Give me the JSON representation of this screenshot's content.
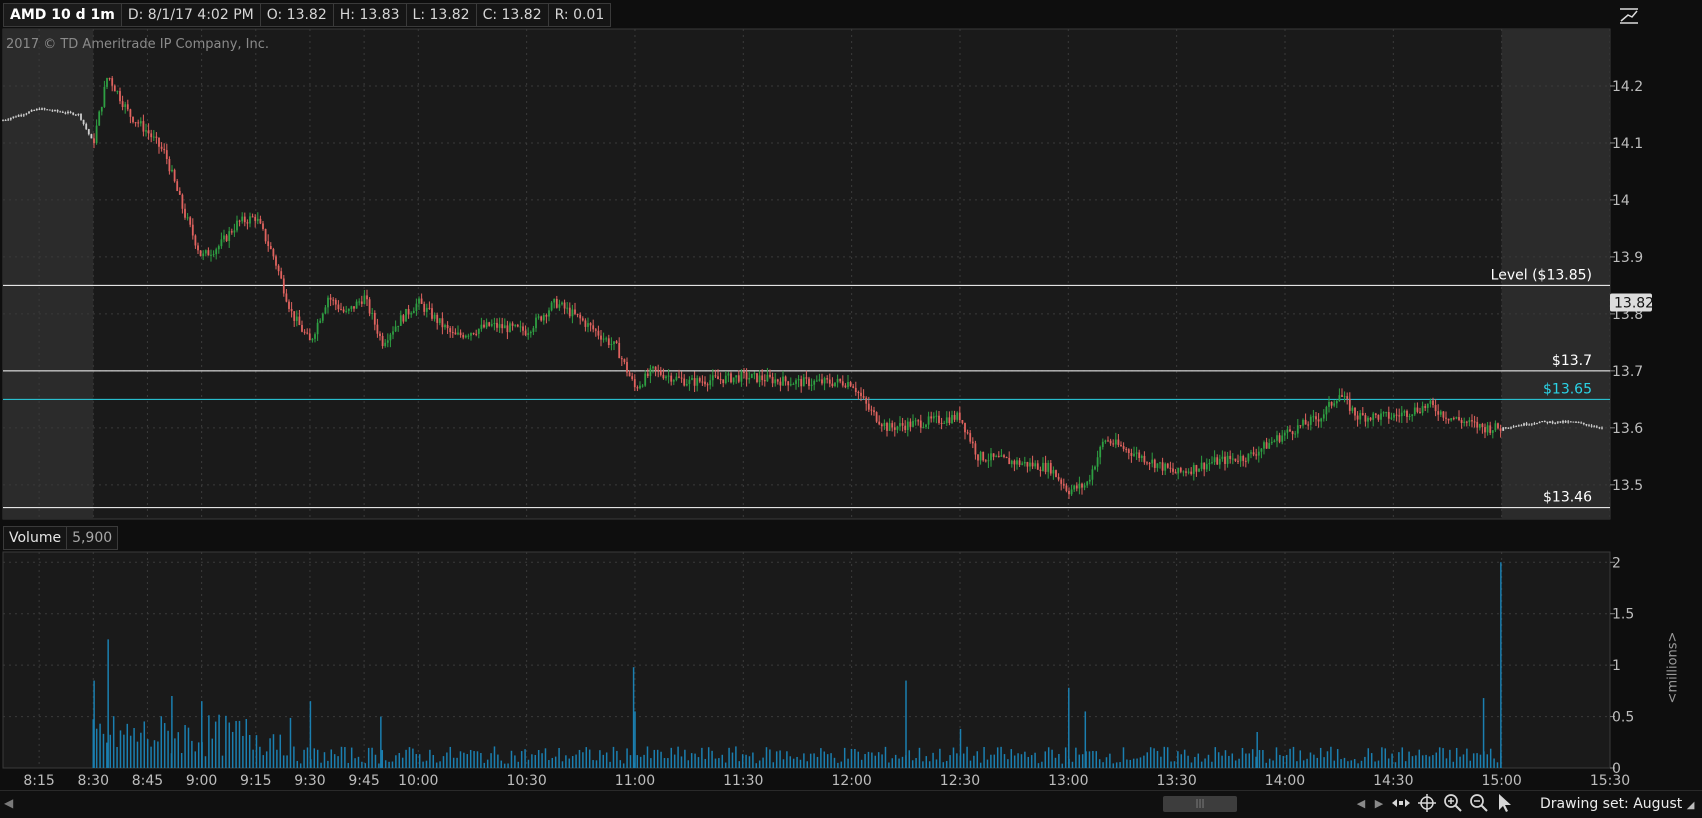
{
  "header": {
    "symbol": "AMD 10 d 1m",
    "date": "D: 8/1/17 4:02 PM",
    "open": "O: 13.82",
    "high": "H: 13.83",
    "low": "L: 13.82",
    "close": "C: 13.82",
    "range": "R: 0.01"
  },
  "copyright": "2017 © TD Ameritrade IP Company, Inc.",
  "volume_panel": {
    "label": "Volume",
    "value": "5,900",
    "unit_label": "<millions>"
  },
  "toolbar": {
    "drawing_set": "Drawing set: August"
  },
  "icons": [
    "drawing-tool-icon",
    "scroll-left-icon",
    "scroll-right-icon",
    "pan-icon",
    "crosshair-icon",
    "zoom-in-icon",
    "zoom-out-icon",
    "cursor-icon"
  ],
  "colors": {
    "up": "#2ea043",
    "down": "#e0635f",
    "volume": "#1b7fb0",
    "level_line": "#ffffff",
    "alert_line": "#2bd3e6",
    "session_shade": "#2b2b2b",
    "plot_bg": "#1a1a1a"
  },
  "chart_data": [
    {
      "type": "candlestick",
      "symbol": "AMD",
      "x_ticks": [
        "8:15",
        "8:30",
        "8:45",
        "9:00",
        "9:15",
        "9:30",
        "9:45",
        "10:00",
        "10:30",
        "11:00",
        "11:30",
        "12:00",
        "12:30",
        "13:00",
        "13:30",
        "14:00",
        "14:30",
        "15:00",
        "15:30"
      ],
      "x_range": [
        "8:05",
        "15:30"
      ],
      "regular_session": [
        "8:30",
        "15:00"
      ],
      "y_ticks": [
        13.5,
        13.6,
        13.7,
        13.8,
        13.9,
        14,
        14.1,
        14.2
      ],
      "ylim": [
        13.44,
        14.3
      ],
      "current_price": "13.82",
      "price_path": [
        {
          "t": "8:05",
          "p": 14.14
        },
        {
          "t": "8:15",
          "p": 14.16
        },
        {
          "t": "8:26",
          "p": 14.15
        },
        {
          "t": "8:30",
          "p": 14.1
        },
        {
          "t": "8:34",
          "p": 14.22
        },
        {
          "t": "8:40",
          "p": 14.15
        },
        {
          "t": "8:45",
          "p": 14.12
        },
        {
          "t": "8:50",
          "p": 14.08
        },
        {
          "t": "8:55",
          "p": 13.98
        },
        {
          "t": "9:00",
          "p": 13.9
        },
        {
          "t": "9:05",
          "p": 13.92
        },
        {
          "t": "9:10",
          "p": 13.96
        },
        {
          "t": "9:15",
          "p": 13.97
        },
        {
          "t": "9:20",
          "p": 13.9
        },
        {
          "t": "9:25",
          "p": 13.8
        },
        {
          "t": "9:30",
          "p": 13.75
        },
        {
          "t": "9:35",
          "p": 13.83
        },
        {
          "t": "9:40",
          "p": 13.8
        },
        {
          "t": "9:45",
          "p": 13.83
        },
        {
          "t": "9:50",
          "p": 13.75
        },
        {
          "t": "9:55",
          "p": 13.79
        },
        {
          "t": "10:00",
          "p": 13.82
        },
        {
          "t": "10:10",
          "p": 13.76
        },
        {
          "t": "10:20",
          "p": 13.78
        },
        {
          "t": "10:30",
          "p": 13.77
        },
        {
          "t": "10:38",
          "p": 13.82
        },
        {
          "t": "10:45",
          "p": 13.79
        },
        {
          "t": "10:55",
          "p": 13.74
        },
        {
          "t": "11:00",
          "p": 13.67
        },
        {
          "t": "11:05",
          "p": 13.7
        },
        {
          "t": "11:15",
          "p": 13.68
        },
        {
          "t": "11:30",
          "p": 13.69
        },
        {
          "t": "11:45",
          "p": 13.68
        },
        {
          "t": "12:00",
          "p": 13.68
        },
        {
          "t": "12:05",
          "p": 13.63
        },
        {
          "t": "12:10",
          "p": 13.6
        },
        {
          "t": "12:20",
          "p": 13.61
        },
        {
          "t": "12:30",
          "p": 13.62
        },
        {
          "t": "12:35",
          "p": 13.55
        },
        {
          "t": "12:45",
          "p": 13.54
        },
        {
          "t": "12:55",
          "p": 13.53
        },
        {
          "t": "13:00",
          "p": 13.49
        },
        {
          "t": "13:05",
          "p": 13.5
        },
        {
          "t": "13:10",
          "p": 13.58
        },
        {
          "t": "13:20",
          "p": 13.55
        },
        {
          "t": "13:30",
          "p": 13.52
        },
        {
          "t": "13:40",
          "p": 13.54
        },
        {
          "t": "13:50",
          "p": 13.55
        },
        {
          "t": "14:00",
          "p": 13.59
        },
        {
          "t": "14:10",
          "p": 13.62
        },
        {
          "t": "14:15",
          "p": 13.66
        },
        {
          "t": "14:20",
          "p": 13.62
        },
        {
          "t": "14:30",
          "p": 13.62
        },
        {
          "t": "14:40",
          "p": 13.64
        },
        {
          "t": "14:45",
          "p": 13.62
        },
        {
          "t": "14:55",
          "p": 13.6
        },
        {
          "t": "15:00",
          "p": 13.6
        },
        {
          "t": "15:10",
          "p": 13.61
        },
        {
          "t": "15:20",
          "p": 13.61
        },
        {
          "t": "15:28",
          "p": 13.6
        }
      ],
      "levels": [
        {
          "label": "Level ($13.85)",
          "price": 13.85,
          "color": "#ffffff"
        },
        {
          "label": "$13.7",
          "price": 13.7,
          "color": "#ffffff"
        },
        {
          "label": "$13.65",
          "price": 13.65,
          "color": "#2bd3e6"
        },
        {
          "label": "$13.46",
          "price": 13.46,
          "color": "#ffffff"
        }
      ]
    },
    {
      "type": "bar",
      "series_label": "Volume",
      "y_ticks": [
        "0",
        "0.5",
        "1",
        "1.5",
        "2"
      ],
      "ylim": [
        0,
        2.1
      ],
      "ylabel": "<millions>",
      "baseline": 0.12,
      "spikes": [
        {
          "t": "8:30",
          "v": 0.85
        },
        {
          "t": "8:34",
          "v": 1.25
        },
        {
          "t": "8:52",
          "v": 0.7
        },
        {
          "t": "9:00",
          "v": 0.65
        },
        {
          "t": "9:30",
          "v": 0.65
        },
        {
          "t": "9:50",
          "v": 0.5
        },
        {
          "t": "11:00",
          "v": 0.98
        },
        {
          "t": "11:00",
          "v": 0.55
        },
        {
          "t": "12:15",
          "v": 0.85
        },
        {
          "t": "12:30",
          "v": 0.38
        },
        {
          "t": "13:00",
          "v": 0.78
        },
        {
          "t": "13:05",
          "v": 0.55
        },
        {
          "t": "13:52",
          "v": 0.35
        },
        {
          "t": "14:55",
          "v": 0.68
        },
        {
          "t": "15:00",
          "v": 2.0
        }
      ]
    }
  ]
}
